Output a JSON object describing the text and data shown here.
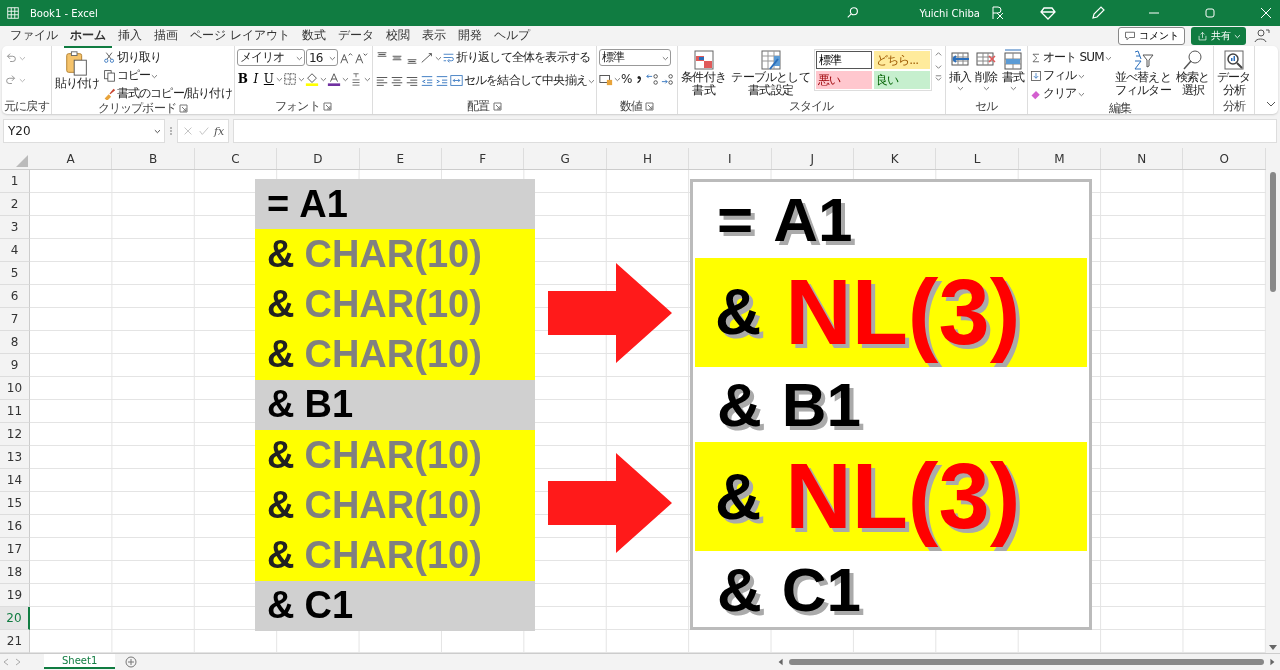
{
  "window": {
    "title": "Book1  -  Excel",
    "user": "Yuichi Chiba"
  },
  "menu_tabs": [
    {
      "label": "ファイル",
      "selected": false
    },
    {
      "label": "ホーム",
      "selected": true
    },
    {
      "label": "挿入",
      "selected": false
    },
    {
      "label": "描画",
      "selected": false
    },
    {
      "label": "ページ レイアウト",
      "selected": false
    },
    {
      "label": "数式",
      "selected": false
    },
    {
      "label": "データ",
      "selected": false
    },
    {
      "label": "校閲",
      "selected": false
    },
    {
      "label": "表示",
      "selected": false
    },
    {
      "label": "開発",
      "selected": false
    },
    {
      "label": "ヘルプ",
      "selected": false
    }
  ],
  "comment_button": "コメント",
  "share_button": "共有",
  "ribbon": {
    "undo": {
      "label": "元に戻す"
    },
    "clipboard": {
      "paste": "貼り付け",
      "cut": "切り取り",
      "copy": "コピー",
      "format_painter": "書式のコピー/貼り付け",
      "label": "クリップボード"
    },
    "font": {
      "font_name": "メイリオ",
      "font_size": "16",
      "bold": "B",
      "italic": "I",
      "underline": "U",
      "label": "フォント"
    },
    "alignment": {
      "wrap_text": "折り返して全体を表示する",
      "merge": "セルを結合して中央揃え",
      "label": "配置"
    },
    "number": {
      "format": "標準",
      "percent": "%",
      "label": "数値"
    },
    "styles": {
      "conditional": "条件付き書式",
      "table": "テーブルとして書式設定",
      "label": "スタイル",
      "cells": [
        {
          "kind": "normal",
          "label": "標準"
        },
        {
          "kind": "neutral",
          "label": "どちら..."
        },
        {
          "kind": "bad",
          "label": "悪い"
        },
        {
          "kind": "good",
          "label": "良い"
        }
      ]
    },
    "cells": {
      "buttons": [
        "挿入",
        "削除",
        "書式"
      ],
      "label": "セル"
    },
    "editing": {
      "autosum": "オート SUM",
      "fill": "フィル",
      "clear": "クリア",
      "sort": "並べ替えとフィルター",
      "find": "検索と選択",
      "label": "編集"
    },
    "analysis": {
      "button": "データ分析",
      "label": "分析"
    }
  },
  "formula_bar": {
    "name_box": "Y20",
    "fx": "fx"
  },
  "columns": [
    "A",
    "B",
    "C",
    "D",
    "E",
    "F",
    "G",
    "H",
    "I",
    "J",
    "K",
    "L",
    "M",
    "N",
    "O"
  ],
  "rows": [
    {
      "label": "1",
      "selected": false
    },
    {
      "label": "2",
      "selected": false
    },
    {
      "label": "3",
      "selected": false
    },
    {
      "label": "4",
      "selected": false
    },
    {
      "label": "5",
      "selected": false
    },
    {
      "label": "6",
      "selected": false
    },
    {
      "label": "7",
      "selected": false
    },
    {
      "label": "8",
      "selected": false
    },
    {
      "label": "9",
      "selected": false
    },
    {
      "label": "10",
      "selected": false
    },
    {
      "label": "11",
      "selected": false
    },
    {
      "label": "12",
      "selected": false
    },
    {
      "label": "13",
      "selected": false
    },
    {
      "label": "14",
      "selected": false
    },
    {
      "label": "15",
      "selected": false
    },
    {
      "label": "16",
      "selected": false
    },
    {
      "label": "17",
      "selected": false
    },
    {
      "label": "18",
      "selected": false
    },
    {
      "label": "19",
      "selected": false
    },
    {
      "label": "20",
      "selected": true
    },
    {
      "label": "21",
      "selected": false
    }
  ],
  "left_panel": [
    {
      "kind": "ref",
      "op": "=",
      "arg": "A1"
    },
    {
      "kind": "char",
      "op": "&",
      "arg": "CHAR(10)"
    },
    {
      "kind": "char",
      "op": "&",
      "arg": "CHAR(10)"
    },
    {
      "kind": "char",
      "op": "&",
      "arg": "CHAR(10)"
    },
    {
      "kind": "ref",
      "op": "&",
      "arg": "B1"
    },
    {
      "kind": "char",
      "op": "&",
      "arg": "CHAR(10)"
    },
    {
      "kind": "char",
      "op": "&",
      "arg": "CHAR(10)"
    },
    {
      "kind": "char",
      "op": "&",
      "arg": "CHAR(10)"
    },
    {
      "kind": "ref",
      "op": "&",
      "arg": "C1"
    }
  ],
  "right_panel": [
    {
      "kind": "ref",
      "op": "=",
      "arg": "A1"
    },
    {
      "kind": "nl",
      "op": "&",
      "arg": "NL(3)"
    },
    {
      "kind": "ref",
      "op": "&",
      "arg": "B1"
    },
    {
      "kind": "nl",
      "op": "&",
      "arg": "NL(3)"
    },
    {
      "kind": "ref",
      "op": "&",
      "arg": "C1"
    }
  ],
  "sheet_tabs": [
    {
      "label": "Sheet1",
      "selected": true
    }
  ]
}
